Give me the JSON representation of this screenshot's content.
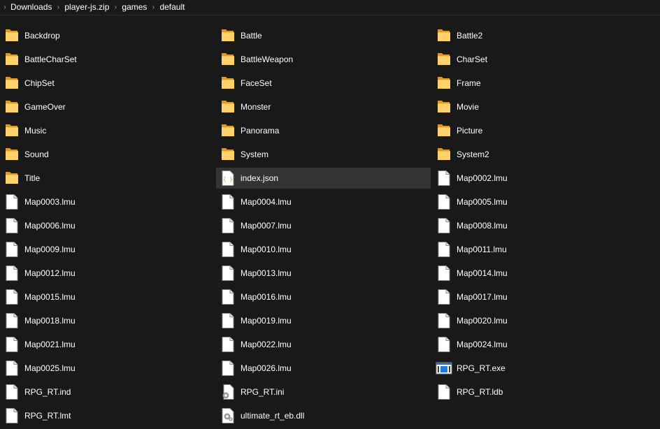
{
  "breadcrumb": [
    "Downloads",
    "player-js.zip",
    "games",
    "default"
  ],
  "items": [
    {
      "name": "Backdrop",
      "icon": "folder-icon"
    },
    {
      "name": "Battle",
      "icon": "folder-icon"
    },
    {
      "name": "Battle2",
      "icon": "folder-icon"
    },
    {
      "name": "BattleCharSet",
      "icon": "folder-icon"
    },
    {
      "name": "BattleWeapon",
      "icon": "folder-icon"
    },
    {
      "name": "CharSet",
      "icon": "folder-icon"
    },
    {
      "name": "ChipSet",
      "icon": "folder-icon"
    },
    {
      "name": "FaceSet",
      "icon": "folder-icon"
    },
    {
      "name": "Frame",
      "icon": "folder-icon"
    },
    {
      "name": "GameOver",
      "icon": "folder-icon"
    },
    {
      "name": "Monster",
      "icon": "folder-icon"
    },
    {
      "name": "Movie",
      "icon": "folder-icon"
    },
    {
      "name": "Music",
      "icon": "folder-icon"
    },
    {
      "name": "Panorama",
      "icon": "folder-icon"
    },
    {
      "name": "Picture",
      "icon": "folder-icon"
    },
    {
      "name": "Sound",
      "icon": "folder-icon"
    },
    {
      "name": "System",
      "icon": "folder-icon"
    },
    {
      "name": "System2",
      "icon": "folder-icon"
    },
    {
      "name": "Title",
      "icon": "folder-icon"
    },
    {
      "name": "index.json",
      "icon": "json-file-icon",
      "selected": true
    },
    {
      "name": "Map0002.lmu",
      "icon": "file-icon"
    },
    {
      "name": "Map0003.lmu",
      "icon": "file-icon"
    },
    {
      "name": "Map0004.lmu",
      "icon": "file-icon"
    },
    {
      "name": "Map0005.lmu",
      "icon": "file-icon"
    },
    {
      "name": "Map0006.lmu",
      "icon": "file-icon"
    },
    {
      "name": "Map0007.lmu",
      "icon": "file-icon"
    },
    {
      "name": "Map0008.lmu",
      "icon": "file-icon"
    },
    {
      "name": "Map0009.lmu",
      "icon": "file-icon"
    },
    {
      "name": "Map0010.lmu",
      "icon": "file-icon"
    },
    {
      "name": "Map0011.lmu",
      "icon": "file-icon"
    },
    {
      "name": "Map0012.lmu",
      "icon": "file-icon"
    },
    {
      "name": "Map0013.lmu",
      "icon": "file-icon"
    },
    {
      "name": "Map0014.lmu",
      "icon": "file-icon"
    },
    {
      "name": "Map0015.lmu",
      "icon": "file-icon"
    },
    {
      "name": "Map0016.lmu",
      "icon": "file-icon"
    },
    {
      "name": "Map0017.lmu",
      "icon": "file-icon"
    },
    {
      "name": "Map0018.lmu",
      "icon": "file-icon"
    },
    {
      "name": "Map0019.lmu",
      "icon": "file-icon"
    },
    {
      "name": "Map0020.lmu",
      "icon": "file-icon"
    },
    {
      "name": "Map0021.lmu",
      "icon": "file-icon"
    },
    {
      "name": "Map0022.lmu",
      "icon": "file-icon"
    },
    {
      "name": "Map0024.lmu",
      "icon": "file-icon"
    },
    {
      "name": "Map0025.lmu",
      "icon": "file-icon"
    },
    {
      "name": "Map0026.lmu",
      "icon": "file-icon"
    },
    {
      "name": "RPG_RT.exe",
      "icon": "exe-file-icon"
    },
    {
      "name": "RPG_RT.ind",
      "icon": "file-icon"
    },
    {
      "name": "RPG_RT.ini",
      "icon": "settings-file-icon"
    },
    {
      "name": "RPG_RT.ldb",
      "icon": "file-icon"
    },
    {
      "name": "RPG_RT.lmt",
      "icon": "file-icon"
    },
    {
      "name": "ultimate_rt_eb.dll",
      "icon": "dll-file-icon"
    }
  ],
  "colors": {
    "background": "#191919",
    "selected": "#333333",
    "folder_back": "#e0a93a",
    "folder_front": "#ffd26b",
    "file": "#ffffff"
  }
}
